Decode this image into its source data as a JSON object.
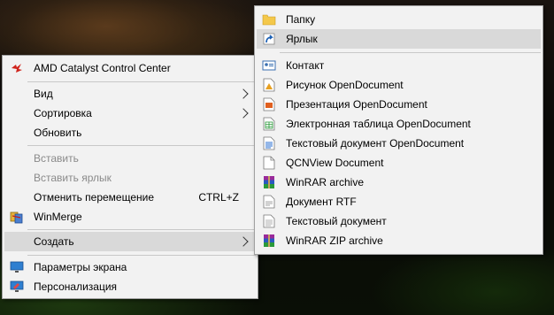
{
  "context_menu": {
    "amd": "AMD Catalyst Control Center",
    "view": "Вид",
    "sort": "Сортировка",
    "refresh": "Обновить",
    "paste": "Вставить",
    "paste_shortcut": "Вставить ярлык",
    "undo_move": "Отменить перемещение",
    "undo_move_shortcut": "CTRL+Z",
    "winmerge": "WinMerge",
    "create": "Создать",
    "display_settings": "Параметры экрана",
    "personalize": "Персонализация"
  },
  "create_submenu": {
    "folder": "Папку",
    "shortcut": "Ярлык",
    "contact": "Контакт",
    "od_drawing": "Рисунок OpenDocument",
    "od_presentation": "Презентация OpenDocument",
    "od_spreadsheet": "Электронная таблица OpenDocument",
    "od_text": "Текстовый документ OpenDocument",
    "qcnview": "QCNView Document",
    "winrar": "WinRAR archive",
    "rtf": "Документ RTF",
    "txt": "Текстовый документ",
    "winrar_zip": "WinRAR ZIP archive"
  },
  "colors": {
    "menu_bg": "#f2f2f2",
    "highlight": "#d9d9d9",
    "disabled_text": "#8a8a8a"
  }
}
